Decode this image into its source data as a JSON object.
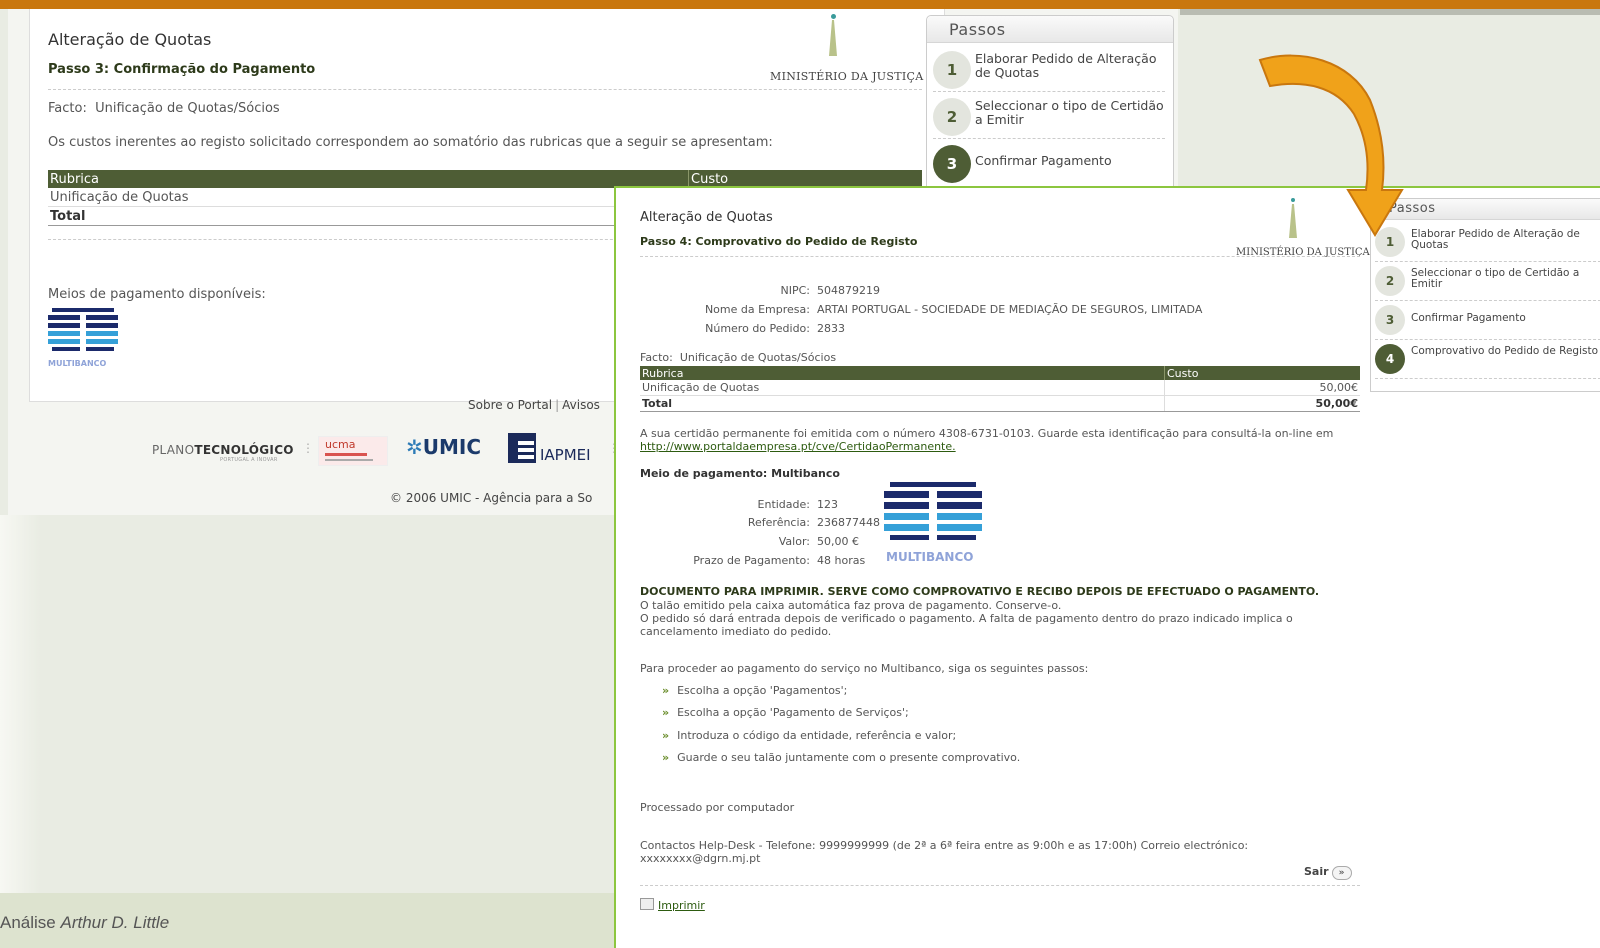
{
  "step3": {
    "title": "Alteração de Quotas",
    "subtitle": "Passo 3: Confirmação do Pagamento",
    "ministry": "MINISTÉRIO DA JUSTIÇA",
    "facto_label": "Facto:",
    "facto_value": "Unificação de Quotas/Sócios",
    "custos_text": "Os custos inerentes ao registo solicitado correspondem ao somatório das rubricas que a seguir se apresentam:",
    "table": {
      "headers": [
        "Rubrica",
        "Custo"
      ],
      "rows": [
        [
          "Unificação de Quotas",
          ""
        ],
        [
          "Total",
          ""
        ]
      ]
    },
    "meios_text": "Meios de pagamento disponíveis:",
    "multibanco_label": "MULTIBANCO",
    "footer_links": [
      "Sobre o Portal",
      "Avisos"
    ],
    "logos": {
      "plano": "PLANO",
      "tecnologico": "TECNOLÓGICO",
      "plano_sub": "PORTUGAL A INOVAR",
      "ucma": "UCMA",
      "umic": "UMIC",
      "iapmei": "IAPMEI"
    },
    "copyright": "© 2006 UMIC - Agência para a So"
  },
  "passos_bg": {
    "title": "Passos",
    "steps": [
      {
        "num": "1",
        "label": "Elaborar Pedido de Alteração de Quotas"
      },
      {
        "num": "2",
        "label": "Seleccionar o tipo de Certidão a Emitir"
      },
      {
        "num": "3",
        "label": "Confirmar Pagamento"
      }
    ]
  },
  "step4": {
    "title": "Alteração de Quotas",
    "subtitle": "Passo 4: Comprovativo do Pedido de Registo",
    "ministry": "MINISTÉRIO DA JUSTIÇA",
    "nipc_label": "NIPC:",
    "nipc": "504879219",
    "empresa_label": "Nome da Empresa:",
    "empresa": "ARTAI PORTUGAL - SOCIEDADE DE MEDIAÇÃO DE SEGUROS, LIMITADA",
    "pedido_label": "Número do Pedido:",
    "pedido": "2833",
    "facto_label": "Facto:",
    "facto_value": "Unificação de Quotas/Sócios",
    "table": {
      "headers": [
        "Rubrica",
        "Custo"
      ],
      "rows": [
        [
          "Unificação de Quotas",
          "50,00€"
        ],
        [
          "Total",
          "50,00€"
        ]
      ]
    },
    "cert_text": "A sua certidão permanente foi emitida com o número 4308-6731-0103. Guarde esta identificação para consultá-la on-line em",
    "cert_link": "http://www.portaldaempresa.pt/cve/CertidaoPermanente.",
    "meio": "Meio de pagamento: Multibanco",
    "entidade_label": "Entidade:",
    "entidade": "123",
    "referencia_label": "Referência:",
    "referencia": "236877448",
    "valor_label": "Valor:",
    "valor": "50,00 €",
    "prazo_label": "Prazo de Pagamento:",
    "prazo": "48 horas",
    "multibanco_label": "MULTIBANCO",
    "doc_heading": "DOCUMENTO PARA IMPRIMIR. SERVE COMO COMPROVATIVO E RECIBO DEPOIS DE EFECTUADO O PAGAMENTO.",
    "doc_line1": "O talão emitido pela caixa automática faz prova de pagamento. Conserve-o.",
    "doc_line2": "O pedido só dará entrada depois de verificado o pagamento. A falta de pagamento dentro do prazo indicado implica o cancelamento imediato do pedido.",
    "proceed": "Para proceder ao pagamento do serviço no Multibanco, siga os seguintes passos:",
    "instructions": [
      "Escolha a opção 'Pagamentos';",
      "Escolha a opção 'Pagamento de Serviços';",
      "Introduza o código da entidade, referência e valor;",
      "Guarde o seu talão juntamente com o presente comprovativo."
    ],
    "processado": "Processado por computador",
    "contact": "Contactos Help-Desk - Telefone: 9999999999 (de 2ª a 6ª feira entre as 9:00h e as 17:00h) Correio electrónico: xxxxxxxx@dgrn.mj.pt",
    "sair": "Sair",
    "imprimir": "Imprimir"
  },
  "passos_fg": {
    "title": "Passos",
    "steps": [
      {
        "num": "1",
        "label": "Elaborar Pedido de Alteração de Quotas"
      },
      {
        "num": "2",
        "label": "Seleccionar o tipo de Certidão a Emitir"
      },
      {
        "num": "3",
        "label": "Confirmar Pagamento"
      },
      {
        "num": "4",
        "label": "Comprovativo do Pedido de Registo"
      }
    ]
  },
  "caption": {
    "prefix": "Análise",
    "author": "Arthur D. Little"
  },
  "colors": {
    "accent_orange": "#c9770e",
    "table_header": "#4e5d35",
    "highlight_border": "#8cc63f",
    "arrow": "#f0a21a"
  }
}
